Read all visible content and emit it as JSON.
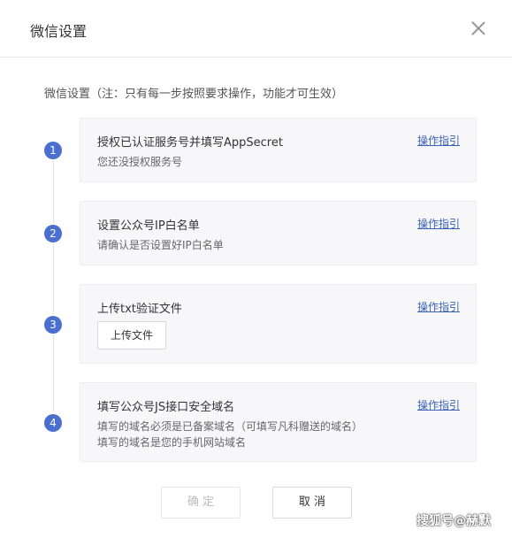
{
  "dialog": {
    "title": "微信设置"
  },
  "intro": "微信设置（注：只有每一步按照要求操作，功能才可生效）",
  "guide_label": "操作指引",
  "steps": [
    {
      "number": "1",
      "title": "授权已认证服务号并填写AppSecret",
      "desc": [
        "您还没授权服务号"
      ]
    },
    {
      "number": "2",
      "title": "设置公众号IP白名单",
      "desc": [
        "请确认是否设置好IP白名单"
      ]
    },
    {
      "number": "3",
      "title": "上传txt验证文件",
      "button": "上传文件"
    },
    {
      "number": "4",
      "title": "填写公众号JS接口安全域名",
      "desc": [
        "填写的域名必须是已备案域名（可填写凡科赠送的域名）",
        "填写的域名是您的手机网站域名"
      ]
    }
  ],
  "footer": {
    "ok_label": "确 定",
    "cancel_label": "取 消"
  },
  "watermark": "搜狐号@赫默",
  "colors": {
    "accent": "#4a6fcf",
    "link": "#3a63b8",
    "card_bg": "#f7f7f9"
  }
}
